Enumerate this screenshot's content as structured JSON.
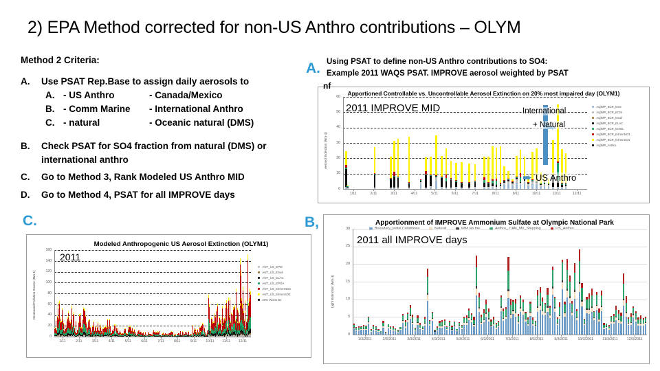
{
  "slide": {
    "title": "2) EPA Method corrected for non-US Anthro contributions – OLYM",
    "accent_color": "#2E9BD6"
  },
  "criteria": {
    "heading": "Method 2 Criteria:",
    "items": [
      {
        "marker": "A.",
        "text": "Use PSAT Rep.Base to assign daily aerosols to",
        "subitems": [
          {
            "marker": "A.",
            "col1": "- US Anthro",
            "col2": "- Canada/Mexico"
          },
          {
            "marker": "B.",
            "col1": "- Comm Marine",
            "col2": "- International Anthro"
          },
          {
            "marker": "C.",
            "col1": "- natural",
            "col2": "- Oceanic natural (DMS)"
          }
        ]
      },
      {
        "marker": "B.",
        "text": "Check PSAT for SO4 fraction from natural (DMS) or international anthro",
        "subitems": []
      },
      {
        "marker": "C.",
        "text": "Go to Method 3, Rank Modeled US Anthro MID",
        "subitems": []
      },
      {
        "marker": "D.",
        "text": "Go to Method 4, PSAT for all IMPROVE days",
        "subitems": []
      }
    ]
  },
  "step_markers": {
    "a": "A.",
    "c": "C.",
    "bd": "B, D,"
  },
  "annotation_a": {
    "line1": "Using PSAT to define non-US Anthro contributions to SO4:",
    "line2": "Example 2011 WAQS PSAT.  IMPROVE aerosol weighted by PSAT",
    "overflow_fragment": "nf"
  },
  "callouts": {
    "international_natural_line1": "International",
    "international_natural_line2": "+ Natural",
    "us_anthro": "US Anthro",
    "arrow_glyph": "➨",
    "color": "#4A90C4"
  },
  "chart_data": [
    {
      "id": "top_right",
      "type": "bar",
      "stacked": true,
      "title": "Apportioned Controllable vs. Uncontrollable Aerosol Extinction on 20% most impaired day (OLYM1)",
      "inplot_label": "2011 IMPROVE MID",
      "xlabel": "",
      "ylabel": "Aerosol Extinction (Mm-1)",
      "ylim": [
        0,
        60
      ],
      "yticks": [
        0,
        10,
        20,
        30,
        40,
        50,
        60
      ],
      "grid": true,
      "legend_position": "right",
      "xticks": [
        "1/11",
        "2/11",
        "3/11",
        "4/11",
        "5/11",
        "6/11",
        "7/11",
        "8/11",
        "9/11",
        "10/11",
        "11/11",
        "12/11"
      ],
      "series": [
        {
          "name": "Aq|IMP_BCR_ESS",
          "color": "#9BB7D4"
        },
        {
          "name": "Aq|IMP_BCR_ECM",
          "color": "#BFBFBF"
        },
        {
          "name": "Aq|IMP_BCR_ESoil",
          "color": "#9E7B3F"
        },
        {
          "name": "Aq|IMP_BCR_ELAC",
          "color": "#111111"
        },
        {
          "name": "Aq|IMP_BCR_EOML",
          "color": "#21A366"
        },
        {
          "name": "Aq|IMP_BCR_E4mmNO3",
          "color": "#C00000"
        },
        {
          "name": "Aq|IMP_BCR_E4mmSO4",
          "color": "#FFF100"
        },
        {
          "name": "Aq|IMP_Anthro",
          "color": "#111111"
        }
      ],
      "points": [
        {
          "x": 0.6,
          "stack": [
            1.0,
            0.5,
            0.0,
            11.5,
            1.0,
            1.5,
            9.0,
            0.0
          ]
        },
        {
          "x": 1.1,
          "stack": [
            0.8,
            0.3,
            0.0,
            0.4,
            0.2,
            0.2,
            0.3,
            0.0
          ]
        },
        {
          "x": 9.2,
          "stack": [
            0.6,
            0.4,
            0.0,
            8.5,
            0.3,
            0.4,
            17.0,
            0.0
          ]
        },
        {
          "x": 14.0,
          "stack": [
            0.5,
            0.3,
            0.0,
            5.5,
            0.3,
            0.4,
            14.0,
            0.0
          ]
        },
        {
          "x": 15.0,
          "stack": [
            0.6,
            0.4,
            0.0,
            7.0,
            0.5,
            2.5,
            20.5,
            0.0
          ]
        },
        {
          "x": 16.2,
          "stack": [
            0.6,
            0.4,
            0.0,
            6.0,
            0.5,
            0.5,
            24.5,
            0.0
          ]
        },
        {
          "x": 19.5,
          "stack": [
            0.5,
            0.3,
            0.0,
            3.0,
            0.4,
            0.4,
            29.5,
            0.0
          ]
        },
        {
          "x": 23.0,
          "stack": [
            3.5,
            1.2,
            0.0,
            0.8,
            0.4,
            0.4,
            0.2,
            0.0
          ]
        },
        {
          "x": 24.5,
          "stack": [
            0.6,
            0.4,
            0.0,
            8.0,
            0.6,
            2.0,
            9.0,
            0.0
          ]
        },
        {
          "x": 26.0,
          "stack": [
            1.0,
            0.6,
            0.0,
            7.0,
            0.5,
            0.5,
            11.5,
            0.0
          ]
        },
        {
          "x": 27.6,
          "stack": [
            5.5,
            2.0,
            0.0,
            0.7,
            0.4,
            0.4,
            26.0,
            0.0
          ]
        },
        {
          "x": 29.2,
          "stack": [
            0.8,
            0.5,
            0.0,
            6.0,
            0.5,
            0.5,
            13.0,
            0.0
          ]
        },
        {
          "x": 30.6,
          "stack": [
            0.7,
            0.4,
            0.0,
            4.0,
            2.0,
            2.5,
            17.0,
            0.0
          ]
        },
        {
          "x": 32.0,
          "stack": [
            0.6,
            0.4,
            0.0,
            5.0,
            0.5,
            0.5,
            11.5,
            0.0
          ]
        },
        {
          "x": 33.6,
          "stack": [
            0.7,
            0.5,
            0.0,
            3.5,
            0.5,
            0.5,
            11.5,
            0.0
          ]
        },
        {
          "x": 35.2,
          "stack": [
            0.6,
            0.4,
            0.0,
            2.5,
            0.5,
            0.5,
            13.0,
            0.0
          ]
        },
        {
          "x": 37.5,
          "stack": [
            0.6,
            0.4,
            0.0,
            2.5,
            0.5,
            0.5,
            12.0,
            0.0
          ]
        },
        {
          "x": 39.2,
          "stack": [
            0.8,
            0.5,
            0.0,
            3.0,
            0.5,
            0.5,
            11.0,
            0.0
          ]
        },
        {
          "x": 42.0,
          "stack": [
            0.7,
            0.5,
            0.0,
            3.0,
            1.5,
            2.0,
            13.5,
            0.0
          ]
        },
        {
          "x": 43.2,
          "stack": [
            0.7,
            0.5,
            0.0,
            2.5,
            0.5,
            0.5,
            16.5,
            0.0
          ]
        },
        {
          "x": 44.4,
          "stack": [
            1.0,
            0.7,
            0.0,
            2.0,
            1.5,
            1.0,
            21.5,
            0.0
          ]
        },
        {
          "x": 45.6,
          "stack": [
            0.8,
            0.6,
            0.0,
            1.5,
            2.5,
            1.5,
            20.0,
            0.0
          ]
        },
        {
          "x": 46.8,
          "stack": [
            1.0,
            0.7,
            0.0,
            1.0,
            0.6,
            0.6,
            24.0,
            0.0
          ]
        },
        {
          "x": 48.0,
          "stack": [
            2.5,
            1.5,
            0.0,
            0.8,
            0.5,
            0.5,
            9.0,
            0.0
          ]
        },
        {
          "x": 49.2,
          "stack": [
            3.0,
            2.0,
            0.0,
            0.7,
            0.5,
            0.5,
            5.0,
            0.0
          ]
        },
        {
          "x": 50.4,
          "stack": [
            2.2,
            1.5,
            0.0,
            0.6,
            0.4,
            0.4,
            1.0,
            0.0
          ]
        },
        {
          "x": 51.6,
          "stack": [
            4.0,
            2.5,
            0.0,
            0.8,
            0.5,
            0.5,
            13.0,
            0.0
          ]
        },
        {
          "x": 52.8,
          "stack": [
            2.5,
            1.5,
            0.0,
            0.6,
            3.0,
            2.5,
            15.5,
            0.0
          ]
        },
        {
          "x": 54.0,
          "stack": [
            3.5,
            2.0,
            0.0,
            0.7,
            0.5,
            0.5,
            14.0,
            0.0
          ]
        },
        {
          "x": 55.2,
          "stack": [
            2.0,
            1.2,
            0.0,
            0.5,
            0.5,
            0.5,
            4.0,
            0.0
          ]
        },
        {
          "x": 56.4,
          "stack": [
            3.0,
            2.0,
            0.0,
            0.6,
            0.4,
            0.4,
            18.0,
            0.0
          ]
        },
        {
          "x": 57.6,
          "stack": [
            2.5,
            1.5,
            0.0,
            0.5,
            0.4,
            0.4,
            21.0,
            0.0
          ]
        },
        {
          "x": 58.8,
          "stack": [
            1.5,
            1.0,
            0.0,
            0.5,
            0.4,
            0.4,
            7.0,
            0.0
          ]
        },
        {
          "x": 60.0,
          "stack": [
            2.0,
            1.2,
            0.0,
            0.6,
            0.5,
            0.5,
            4.0,
            0.0
          ]
        },
        {
          "x": 61.2,
          "stack": [
            1.5,
            1.0,
            0.0,
            0.5,
            0.4,
            0.4,
            3.0,
            0.0
          ]
        },
        {
          "x": 62.6,
          "stack": [
            0.8,
            0.5,
            0.0,
            6.5,
            0.5,
            0.5,
            23.0,
            0.0
          ]
        },
        {
          "x": 64.0,
          "stack": [
            0.7,
            0.5,
            0.0,
            4.0,
            12.0,
            0.8,
            37.0,
            0.0
          ]
        },
        {
          "x": 65.2,
          "stack": [
            0.8,
            0.6,
            0.0,
            1.5,
            0.6,
            0.6,
            22.0,
            0.0
          ]
        },
        {
          "x": 66.4,
          "stack": [
            1.0,
            0.8,
            0.0,
            1.0,
            0.6,
            0.6,
            19.5,
            0.0
          ]
        }
      ]
    },
    {
      "id": "bottom_left",
      "type": "area",
      "stacked": true,
      "title": "Modeled Anthropogenic US Aerosol Extinction (OLYM1)",
      "inplot_label": "2011",
      "xlabel": "",
      "ylabel": "Decreased Pollution Source (Mm-1)",
      "ylim": [
        0,
        160
      ],
      "yticks": [
        0,
        20,
        40,
        60,
        80,
        100,
        120,
        140,
        160
      ],
      "grid": true,
      "legend_position": "right",
      "xticks": [
        "1/11",
        "2/11",
        "3/11",
        "4/11",
        "5/11",
        "6/11",
        "7/11",
        "8/11",
        "9/11",
        "10/11",
        "11/11",
        "12/11"
      ],
      "series": [
        {
          "name": "ANT_US_EPM",
          "color": "#BFBFBF"
        },
        {
          "name": "ANT_US_ESoil",
          "color": "#9E7B3F"
        },
        {
          "name": "ANT_US_ELAC",
          "color": "#111111"
        },
        {
          "name": "ANT_US_EPOA",
          "color": "#21A366"
        },
        {
          "name": "ANT_US_E4mmNO3",
          "color": "#C00000"
        },
        {
          "name": "ANT_US_E4mmSO4",
          "color": "#FFF100"
        },
        {
          "name": "20% Worst Dv",
          "color": "#111111"
        }
      ],
      "note": "Dense daily time-series; tall peaks in Jan-Feb (~60-65) and Oct-Dec (~145 max), quiet summer baseline (~5-15)."
    },
    {
      "id": "bottom_right",
      "type": "bar",
      "stacked": true,
      "title": "Apportionment of IMPROVE Ammonium Sulfate at Olympic National Park",
      "inplot_label": "2011 all IMPROVE days",
      "xlabel": "",
      "ylabel": "Light Extinction (Mm-1)",
      "ylim": [
        0,
        30
      ],
      "yticks": [
        0,
        5,
        10,
        15,
        20,
        25,
        30
      ],
      "grid": true,
      "legend_position": "bottom",
      "xticks": [
        "1/3/2011",
        "2/3/2011",
        "3/3/2011",
        "4/3/2011",
        "5/3/2011",
        "6/3/2011",
        "7/3/2011",
        "8/3/2011",
        "9/3/2011",
        "10/3/2011",
        "11/3/2011",
        "12/3/2011"
      ],
      "series": [
        {
          "name": "Boundary_Initial Conditions",
          "color": "#6C9BC8"
        },
        {
          "name": "Natural",
          "color": "#F3DBBA"
        },
        {
          "name": "Wild Rx fire",
          "color": "#3B3B3B"
        },
        {
          "name": "Anthro_ CAN_MX_Shipping",
          "color": "#2FA36B"
        },
        {
          "name": "US_Anthro",
          "color": "#B32020"
        }
      ],
      "note": "Approximately 120 daily stacked bars across 2011; maxima near 24-27 in late Aug/Sep, lows under 2 in winter."
    }
  ]
}
